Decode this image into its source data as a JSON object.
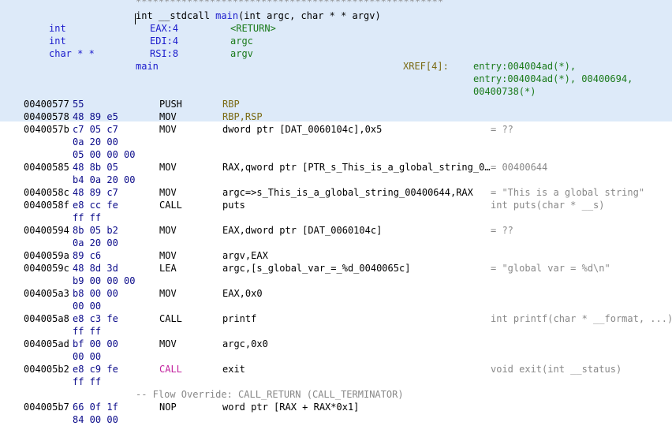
{
  "header": {
    "stars": "******************************************************",
    "signature_prefix": "int __stdcall ",
    "signature_name": "main",
    "signature_suffix": "(int argc, char * * argv)",
    "params": [
      {
        "type": "int",
        "storage": "EAX:4",
        "name": "<RETURN>"
      },
      {
        "type": "int",
        "storage": "EDI:4",
        "name": "argc"
      },
      {
        "type": "char * *",
        "storage": "RSI:8",
        "name": "argv"
      }
    ],
    "label": "main",
    "xref_label": "XREF[4]:",
    "xrefs": [
      "entry:004004ad(*),",
      "entry:004004ad(*), 00400694,",
      "00400738(*)"
    ]
  },
  "rows": [
    {
      "addr": "00400577",
      "bytes": "55",
      "mnemonic": "PUSH",
      "operand": "RBP",
      "comment": ""
    },
    {
      "addr": "00400578",
      "bytes": "48 89 e5",
      "mnemonic": "MOV",
      "operand": "RBP,RSP",
      "comment": ""
    },
    {
      "addr": "0040057b",
      "bytes": "c7 05 c7",
      "mnemonic": "MOV",
      "operand": "dword ptr [DAT_0060104c],0x5",
      "comment": "= ??"
    },
    {
      "addr": "",
      "bytes": "0a 20 00",
      "mnemonic": "",
      "operand": "",
      "comment": ""
    },
    {
      "addr": "",
      "bytes": "05 00 00 00",
      "mnemonic": "",
      "operand": "",
      "comment": ""
    },
    {
      "addr": "00400585",
      "bytes": "48 8b 05",
      "mnemonic": "MOV",
      "operand": "RAX,qword ptr [PTR_s_This_is_a_global_string_0…",
      "comment": "= 00400644"
    },
    {
      "addr": "",
      "bytes": "b4 0a 20 00",
      "mnemonic": "",
      "operand": "",
      "comment": ""
    },
    {
      "addr": "0040058c",
      "bytes": "48 89 c7",
      "mnemonic": "MOV",
      "operand": "argc=>s_This_is_a_global_string_00400644,RAX",
      "comment": "= \"This is a global string\""
    },
    {
      "addr": "0040058f",
      "bytes": "e8 cc fe",
      "mnemonic": "CALL",
      "operand": "puts",
      "comment": "int puts(char * __s)"
    },
    {
      "addr": "",
      "bytes": "ff ff",
      "mnemonic": "",
      "operand": "",
      "comment": ""
    },
    {
      "addr": "00400594",
      "bytes": "8b 05 b2",
      "mnemonic": "MOV",
      "operand": "EAX,dword ptr [DAT_0060104c]",
      "comment": "= ??"
    },
    {
      "addr": "",
      "bytes": "0a 20 00",
      "mnemonic": "",
      "operand": "",
      "comment": ""
    },
    {
      "addr": "0040059a",
      "bytes": "89 c6",
      "mnemonic": "MOV",
      "operand": "argv,EAX",
      "comment": ""
    },
    {
      "addr": "0040059c",
      "bytes": "48 8d 3d",
      "mnemonic": "LEA",
      "operand": "argc,[s_global_var_=_%d_0040065c]",
      "comment": "= \"global var = %d\\n\""
    },
    {
      "addr": "",
      "bytes": "b9 00 00 00",
      "mnemonic": "",
      "operand": "",
      "comment": ""
    },
    {
      "addr": "004005a3",
      "bytes": "b8 00 00",
      "mnemonic": "MOV",
      "operand": "EAX,0x0",
      "comment": ""
    },
    {
      "addr": "",
      "bytes": "00 00",
      "mnemonic": "",
      "operand": "",
      "comment": ""
    },
    {
      "addr": "004005a8",
      "bytes": "e8 c3 fe",
      "mnemonic": "CALL",
      "operand": "printf",
      "comment": "int printf(char * __format, ...)"
    },
    {
      "addr": "",
      "bytes": "ff ff",
      "mnemonic": "",
      "operand": "",
      "comment": ""
    },
    {
      "addr": "004005ad",
      "bytes": "bf 00 00",
      "mnemonic": "MOV",
      "operand": "argc,0x0",
      "comment": ""
    },
    {
      "addr": "",
      "bytes": "00 00",
      "mnemonic": "",
      "operand": "",
      "comment": ""
    },
    {
      "addr": "004005b2",
      "bytes": "e8 c9 fe",
      "mnemonic": "CALL",
      "operand": "exit",
      "comment": "void exit(int __status)"
    },
    {
      "addr": "",
      "bytes": "ff ff",
      "mnemonic": "",
      "operand": "",
      "comment": ""
    },
    {
      "addr": "",
      "bytes": "",
      "mnemonic": "",
      "operand": "",
      "comment": "-- Flow Override: CALL_RETURN (CALL_TERMINATOR)"
    },
    {
      "addr": "004005b7",
      "bytes": "66 0f 1f",
      "mnemonic": "NOP",
      "operand": "word ptr [RAX + RAX*0x1]",
      "comment": ""
    },
    {
      "addr": "",
      "bytes": "84 00 00",
      "mnemonic": "",
      "operand": "",
      "comment": ""
    }
  ]
}
